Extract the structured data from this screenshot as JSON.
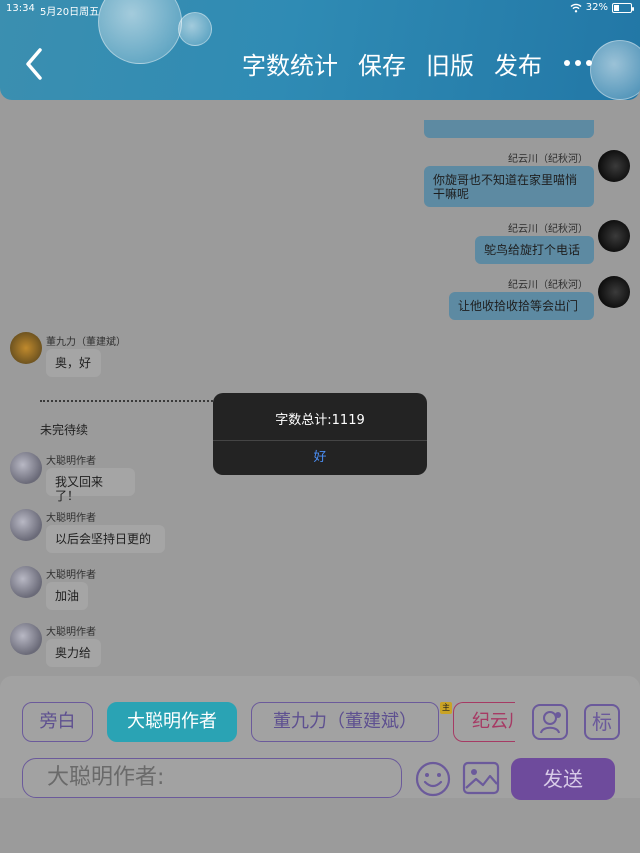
{
  "status_bar": {
    "time": "13:34",
    "date": "5月20日周五",
    "battery": "32%",
    "battery_level": 0.32
  },
  "header": {
    "nav": [
      "字数统计",
      "保存",
      "旧版",
      "发布"
    ]
  },
  "messages": [
    {
      "side": "right",
      "name": "纪云川（纪秋河）",
      "text": "你旋哥也不知道在家里喵悄\n干嘛呢"
    },
    {
      "side": "right",
      "name": "纪云川（纪秋河）",
      "text": "鸵鸟给旋打个电话"
    },
    {
      "side": "right",
      "name": "纪云川（纪秋河）",
      "text": "让他收拾收拾等会出门"
    },
    {
      "side": "left",
      "name": "董九力（董建斌）",
      "text": "奥，好"
    },
    {
      "side": "left",
      "name": "大聪明作者",
      "text": "我又回来了！"
    },
    {
      "side": "left",
      "name": "大聪明作者",
      "text": "以后会坚持日更的"
    },
    {
      "side": "left",
      "name": "大聪明作者",
      "text": "加油"
    },
    {
      "side": "left",
      "name": "大聪明作者",
      "text": "奥力给"
    }
  ],
  "narration": "未完待续",
  "characters": [
    "旁白",
    "大聪明作者",
    "董九力（董建斌）",
    "纪云川"
  ],
  "char_tag": "主",
  "side_buttons": {
    "mark": "标"
  },
  "input": {
    "placeholder": "大聪明作者:",
    "send": "发送"
  },
  "dialog": {
    "message": "字数总计:1119",
    "ok": "好"
  }
}
